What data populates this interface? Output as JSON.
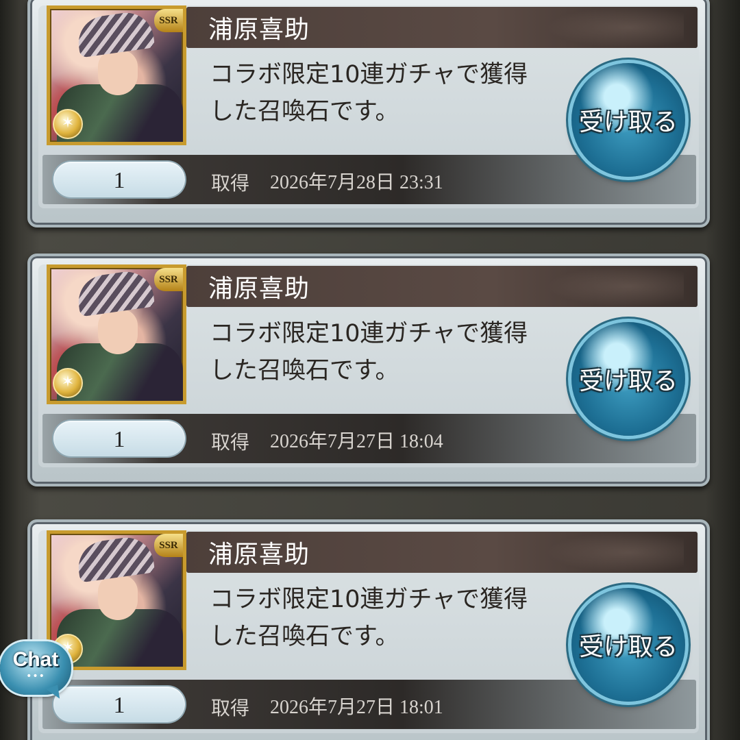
{
  "chat": {
    "label": "Chat",
    "dots": "•••"
  },
  "items": [
    {
      "name": "浦原喜助",
      "rarity": "SSR",
      "description": "コラボ限定10連ガチャで獲得\nした召喚石です。",
      "quantity": "1",
      "acquired_label": "取得",
      "acquired_date": "2026年7月28日 23:31",
      "receive_label": "受け取る"
    },
    {
      "name": "浦原喜助",
      "rarity": "SSR",
      "description": "コラボ限定10連ガチャで獲得\nした召喚石です。",
      "quantity": "1",
      "acquired_label": "取得",
      "acquired_date": "2026年7月27日 18:04",
      "receive_label": "受け取る"
    },
    {
      "name": "浦原喜助",
      "rarity": "SSR",
      "description": "コラボ限定10連ガチャで獲得\nした召喚石です。",
      "quantity": "1",
      "acquired_label": "取得",
      "acquired_date": "2026年7月27日 18:01",
      "receive_label": "受け取る"
    }
  ]
}
